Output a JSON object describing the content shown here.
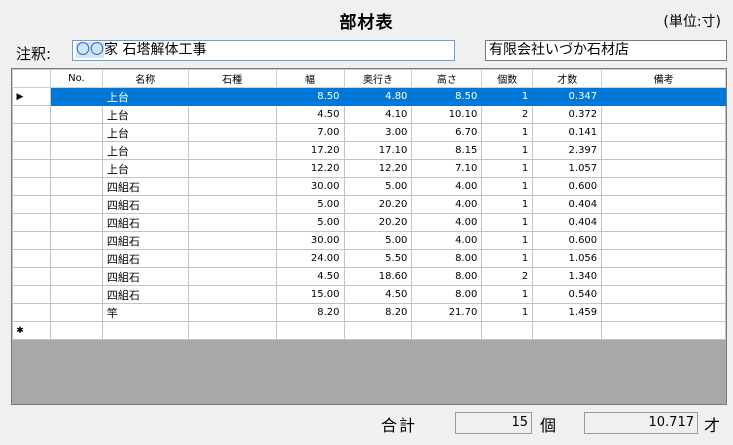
{
  "header": {
    "title": "部材表",
    "unit": "(単位:寸)",
    "note_label": "注釈:",
    "note_selected": "〇〇",
    "note_rest": "家 石塔解体工事",
    "company": "有限会社いづか石材店"
  },
  "table": {
    "columns": [
      "No.",
      "名称",
      "石種",
      "幅",
      "奥行き",
      "高さ",
      "個数",
      "才数",
      "備考"
    ],
    "row_marker_current": "▶",
    "row_marker_new": "✱",
    "rows": [
      {
        "no": "",
        "name": "上台",
        "stone": "",
        "w": "8.50",
        "d": "4.80",
        "h": "8.50",
        "qty": "1",
        "sai": "0.347",
        "memo": ""
      },
      {
        "no": "",
        "name": "上台",
        "stone": "",
        "w": "4.50",
        "d": "4.10",
        "h": "10.10",
        "qty": "2",
        "sai": "0.372",
        "memo": ""
      },
      {
        "no": "",
        "name": "上台",
        "stone": "",
        "w": "7.00",
        "d": "3.00",
        "h": "6.70",
        "qty": "1",
        "sai": "0.141",
        "memo": ""
      },
      {
        "no": "",
        "name": "上台",
        "stone": "",
        "w": "17.20",
        "d": "17.10",
        "h": "8.15",
        "qty": "1",
        "sai": "2.397",
        "memo": ""
      },
      {
        "no": "",
        "name": "上台",
        "stone": "",
        "w": "12.20",
        "d": "12.20",
        "h": "7.10",
        "qty": "1",
        "sai": "1.057",
        "memo": ""
      },
      {
        "no": "",
        "name": "四組石",
        "stone": "",
        "w": "30.00",
        "d": "5.00",
        "h": "4.00",
        "qty": "1",
        "sai": "0.600",
        "memo": ""
      },
      {
        "no": "",
        "name": "四組石",
        "stone": "",
        "w": "5.00",
        "d": "20.20",
        "h": "4.00",
        "qty": "1",
        "sai": "0.404",
        "memo": ""
      },
      {
        "no": "",
        "name": "四組石",
        "stone": "",
        "w": "5.00",
        "d": "20.20",
        "h": "4.00",
        "qty": "1",
        "sai": "0.404",
        "memo": ""
      },
      {
        "no": "",
        "name": "四組石",
        "stone": "",
        "w": "30.00",
        "d": "5.00",
        "h": "4.00",
        "qty": "1",
        "sai": "0.600",
        "memo": ""
      },
      {
        "no": "",
        "name": "四組石",
        "stone": "",
        "w": "24.00",
        "d": "5.50",
        "h": "8.00",
        "qty": "1",
        "sai": "1.056",
        "memo": ""
      },
      {
        "no": "",
        "name": "四組石",
        "stone": "",
        "w": "4.50",
        "d": "18.60",
        "h": "8.00",
        "qty": "2",
        "sai": "1.340",
        "memo": ""
      },
      {
        "no": "",
        "name": "四組石",
        "stone": "",
        "w": "15.00",
        "d": "4.50",
        "h": "8.00",
        "qty": "1",
        "sai": "0.540",
        "memo": ""
      },
      {
        "no": "",
        "name": "竿",
        "stone": "",
        "w": "8.20",
        "d": "8.20",
        "h": "21.70",
        "qty": "1",
        "sai": "1.459",
        "memo": ""
      }
    ]
  },
  "footer": {
    "total_label": "合計",
    "total_count": "15",
    "count_unit": "個",
    "total_sai": "10.717",
    "sai_unit": "才"
  }
}
